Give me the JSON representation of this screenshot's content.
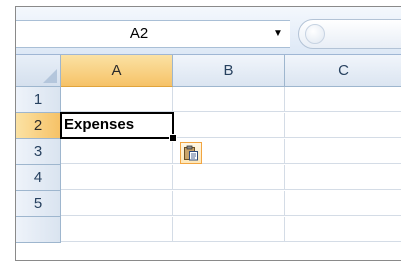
{
  "formula_bar": {
    "name_box": "A2",
    "dropdown_glyph": "▼",
    "function_icon": "insert-function-icon"
  },
  "columns": [
    {
      "label": "A",
      "active": true
    },
    {
      "label": "B",
      "active": false
    },
    {
      "label": "C",
      "active": false
    }
  ],
  "rows": [
    {
      "label": "1",
      "active": false,
      "cells": [
        "",
        "",
        ""
      ]
    },
    {
      "label": "2",
      "active": true,
      "cells": [
        "Expenses",
        "",
        ""
      ]
    },
    {
      "label": "3",
      "active": false,
      "cells": [
        "",
        "",
        ""
      ]
    },
    {
      "label": "4",
      "active": false,
      "cells": [
        "",
        "",
        ""
      ]
    },
    {
      "label": "5",
      "active": false,
      "cells": [
        "",
        "",
        ""
      ]
    }
  ],
  "selected_cell": "A2",
  "paste_options_icon": "paste-options-icon",
  "colors": {
    "header_bg": "#dbe5f1",
    "active_header_bg": "#f6c267",
    "grid_line": "#d4dce6",
    "paste_border": "#f2a541"
  }
}
